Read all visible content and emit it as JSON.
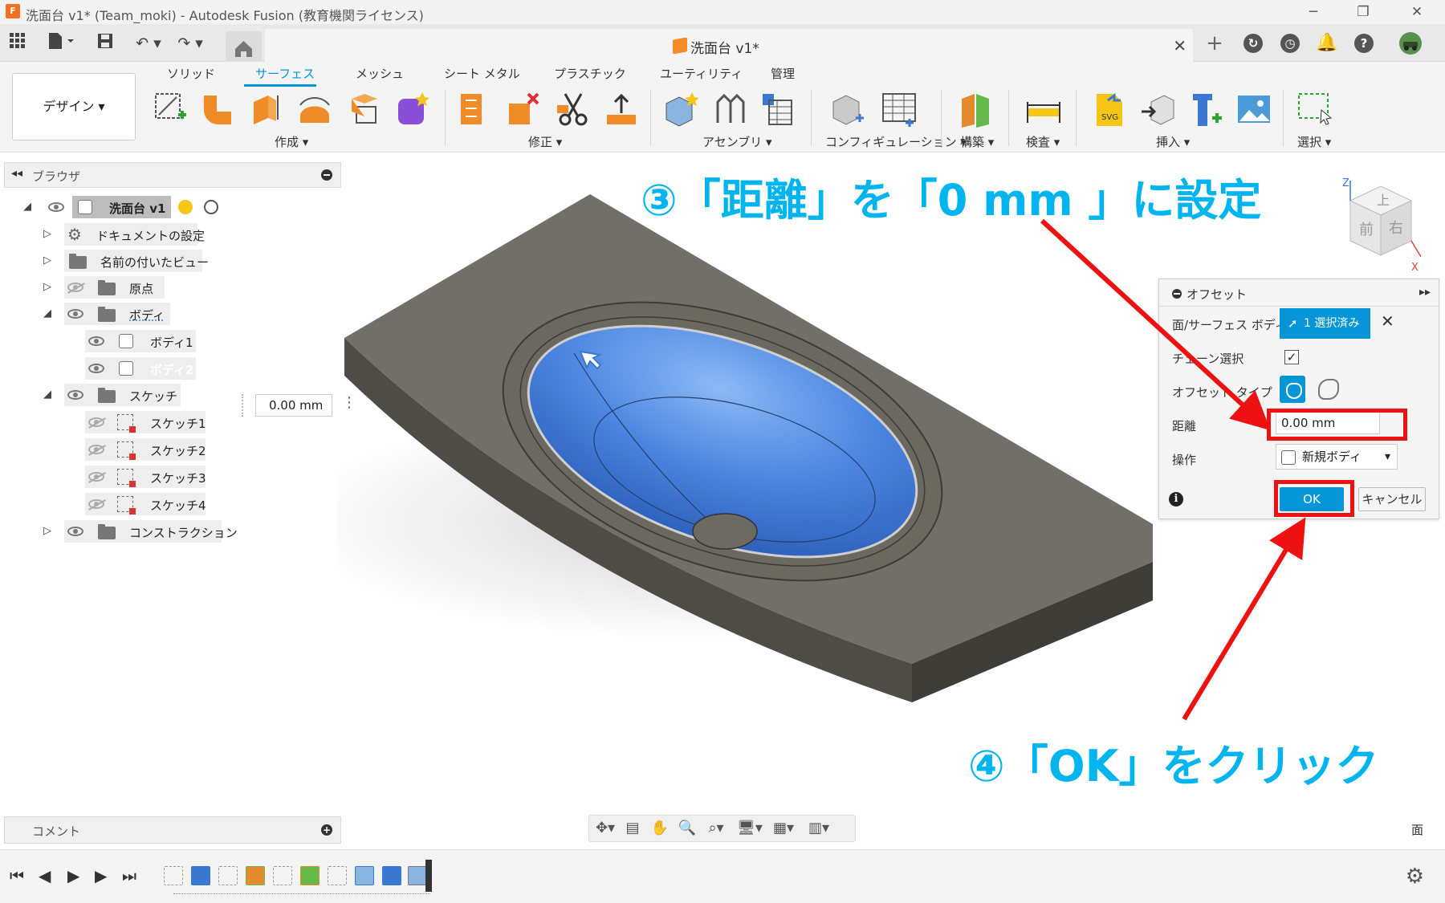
{
  "window": {
    "app_icon_letter": "F",
    "title": "洗面台 v1* (Team_moki) - Autodesk Fusion (教育機関ライセンス)",
    "min_label": "─",
    "max_label": "❐",
    "close_label": "✕"
  },
  "tabbar": {
    "doc_tab": "洗面台 v1*",
    "close_tab": "✕",
    "new_tab": "+"
  },
  "ribbon": {
    "workspace": "デザイン ▾",
    "tabs": [
      "ソリッド",
      "サーフェス",
      "メッシュ",
      "シート メタル",
      "プラスチック",
      "ユーティリティ",
      "管理"
    ],
    "active_tab_index": 1,
    "groups": [
      "作成 ▾",
      "修正 ▾",
      "アセンブリ ▾",
      "コンフィギュレーション ▾",
      "構築 ▾",
      "検査 ▾",
      "挿入 ▾",
      "選択 ▾"
    ]
  },
  "browser": {
    "title": "ブラウザ",
    "root": "洗面台 v1",
    "items": [
      "ドキュメントの設定",
      "名前の付いたビュー",
      "原点",
      "ボディ",
      "ボディ1",
      "ボディ2",
      "スケッチ",
      "スケッチ1",
      "スケッチ2",
      "スケッチ3",
      "スケッチ4",
      "コンストラクション"
    ],
    "selected": "ボディ2"
  },
  "viewport": {
    "distance_input": "0.00 mm",
    "viewcube": {
      "top": "上",
      "front": "前",
      "right": "右",
      "z": "Z",
      "x": "X"
    }
  },
  "dialog": {
    "title": "オフセット",
    "expand": "▸▸",
    "rows": {
      "faces_label": "面/サーフェス ボディ",
      "faces_value": "1 選択済み",
      "chain_label": "チェーン選択",
      "chain_checked": "✓",
      "type_label": "オフセット タイプ",
      "distance_label": "距離",
      "distance_value": "0.00 mm",
      "operation_label": "操作",
      "operation_value": "新規ボディ"
    },
    "info": "i",
    "ok": "OK",
    "cancel": "キャンセル"
  },
  "annotations": {
    "step3": "③「距離」を「0 mm 」に設定",
    "step4": "④「OK」をクリック",
    "color": "#00b5ef",
    "highlight_color": "#ee1111"
  },
  "comments": {
    "title": "コメント"
  },
  "status": {
    "face_label": "面"
  },
  "colors": {
    "accent": "#0696d7",
    "body": "#6b6a62",
    "basin": "#3a78d4"
  }
}
